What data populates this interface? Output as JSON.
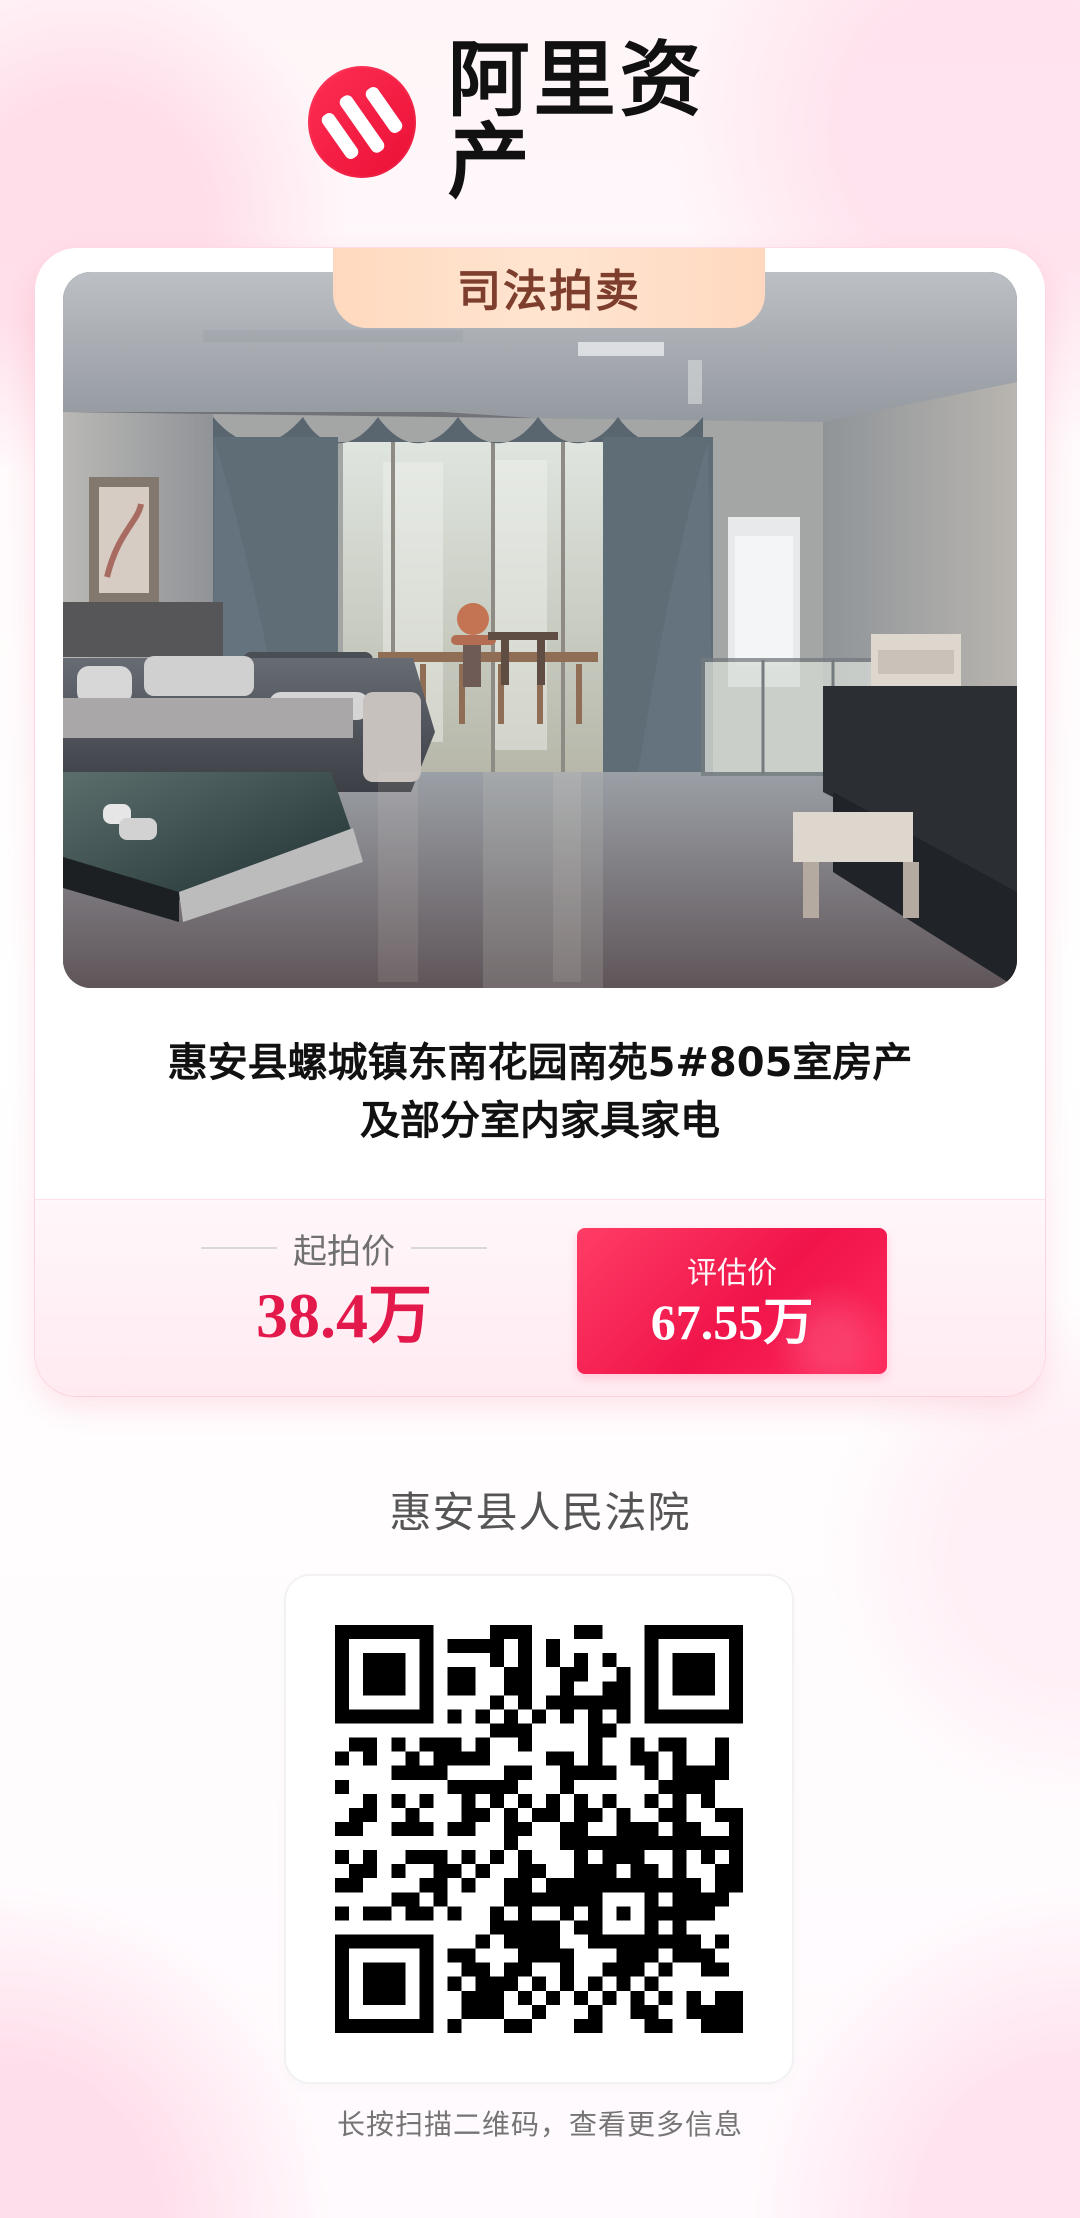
{
  "brand": {
    "name": "阿里资产",
    "mark_icon": "ali-assets-logo-icon"
  },
  "auction": {
    "tag": "司法拍卖",
    "title_lines": [
      "惠安县螺城镇东南花园南苑5#805室房产",
      "及部分室内家具家电"
    ],
    "start_price_label": "起拍价",
    "start_price": "38.4万",
    "estimate_label": "评估价",
    "estimate_price": "67.55万"
  },
  "court": "惠安县人民法院",
  "qr": {
    "hint": "长按扫描二维码，查看更多信息"
  },
  "colors": {
    "brand_red": "#ea0f35",
    "price_red": "#e3194b",
    "tag_peach": "#ffe0ca"
  }
}
